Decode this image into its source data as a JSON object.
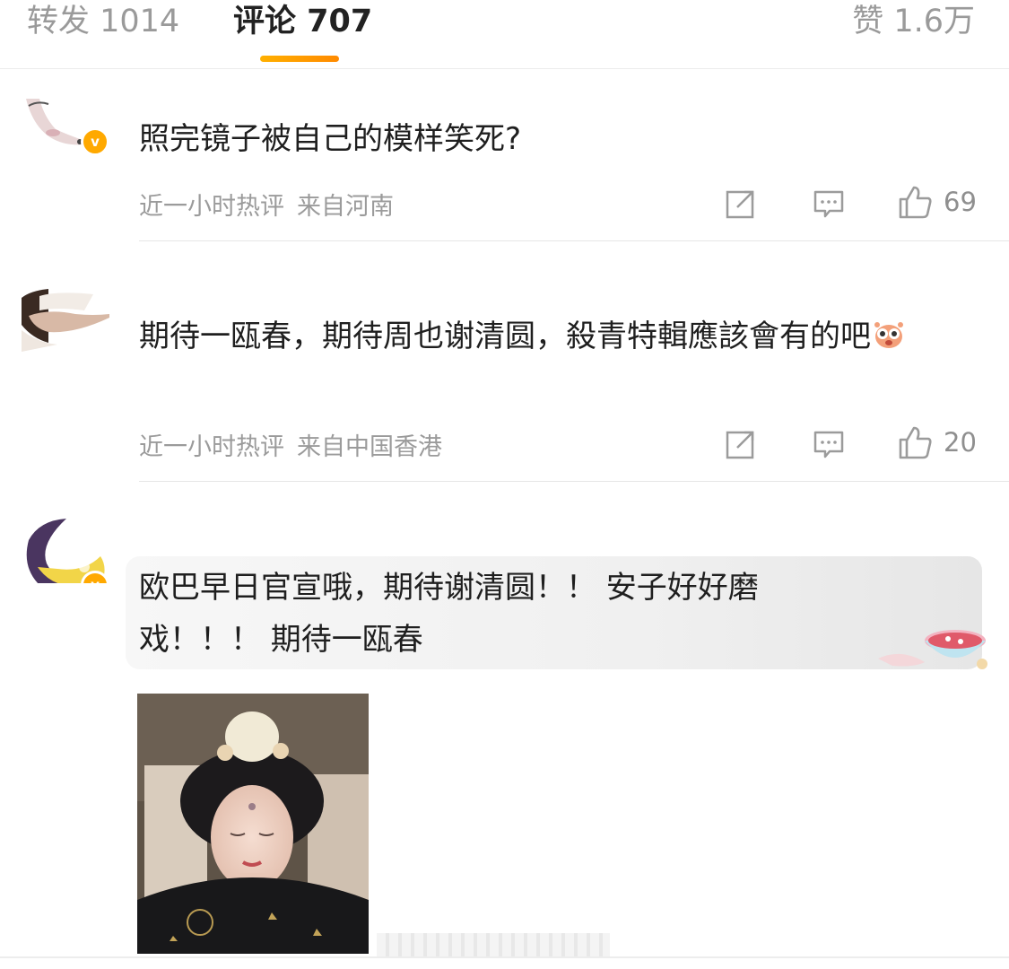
{
  "tabs": {
    "repost_label": "转发 1014",
    "comments_label": "评论 707",
    "likes_label": "赞 1.6万",
    "accent_color": "#ff9a00"
  },
  "comments": [
    {
      "text": "照完镜子被自己的模样笑死?",
      "meta_time": "近一小时热评",
      "meta_location": "来自河南",
      "like_count": "69",
      "icons": [
        "share-icon",
        "reply-icon",
        "thumbs-up-icon"
      ],
      "verified": true
    },
    {
      "text": "期待一瓯春，期待周也谢清圆，殺青特輯應該會有的吧",
      "meta_time": "近一小时热评",
      "meta_location": "来自中国香港",
      "like_count": "20",
      "icons": [
        "share-icon",
        "reply-icon",
        "thumbs-up-icon"
      ],
      "verified": false
    },
    {
      "text": "欧巴早日官宣哦，期待谢清圆！！ 安子好好磨戏！！！ 期待一瓯春",
      "verified": true
    }
  ]
}
